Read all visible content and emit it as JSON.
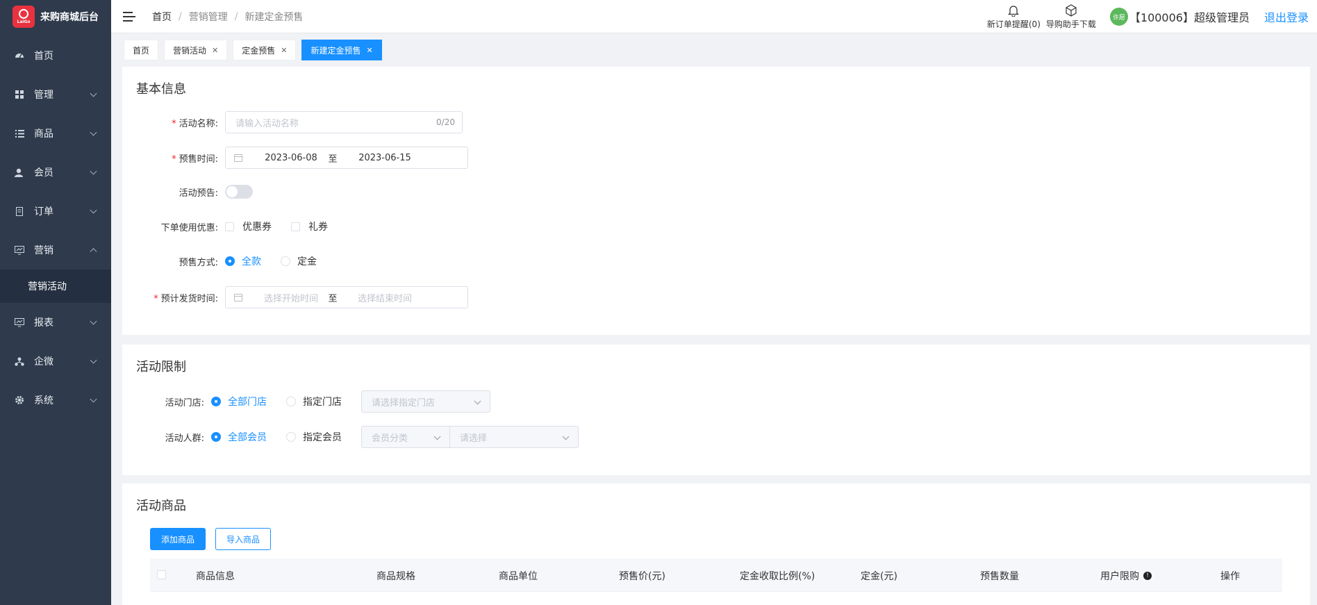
{
  "app": {
    "brand": "来购商城后台",
    "logo_text": "LaiGo"
  },
  "sidebar": {
    "items": [
      {
        "label": "首页",
        "icon": "dashboard-icon",
        "chevron": ""
      },
      {
        "label": "管理",
        "icon": "grid-icon",
        "chevron": "down"
      },
      {
        "label": "商品",
        "icon": "list-icon",
        "chevron": "down"
      },
      {
        "label": "会员",
        "icon": "user-icon",
        "chevron": "down"
      },
      {
        "label": "订单",
        "icon": "document-icon",
        "chevron": "down"
      },
      {
        "label": "营销",
        "icon": "monitor-icon",
        "chevron": "up"
      }
    ],
    "submenu": {
      "label": "营销活动"
    },
    "items_after": [
      {
        "label": "报表",
        "icon": "monitor-icon",
        "chevron": "down"
      },
      {
        "label": "企微",
        "icon": "org-icon",
        "chevron": "down"
      },
      {
        "label": "系统",
        "icon": "gear-icon",
        "chevron": "down"
      }
    ]
  },
  "header": {
    "breadcrumb": [
      "首页",
      "营销管理",
      "新建定金预售"
    ],
    "order_alert": "新订单提醒(0)",
    "download": "导购助手下载",
    "user_badge": "许愿",
    "user": "【100006】超级管理员",
    "logout": "退出登录"
  },
  "tabs": [
    {
      "label": "首页",
      "closable": false,
      "active": false
    },
    {
      "label": "营销活动",
      "closable": true,
      "active": false
    },
    {
      "label": "定金预售",
      "closable": true,
      "active": false
    },
    {
      "label": "新建定金预售",
      "closable": true,
      "active": true
    }
  ],
  "basic": {
    "title": "基本信息",
    "name_label": "活动名称:",
    "name_placeholder": "请输入活动名称",
    "name_count": "0/20",
    "presale_label": "预售时间:",
    "presale_start": "2023-06-08",
    "presale_to": "至",
    "presale_end": "2023-06-15",
    "preview_label": "活动预告:",
    "discount_label": "下单使用优惠:",
    "coupon": "优惠券",
    "gift": "礼券",
    "mode_label": "预售方式:",
    "mode_full": "全款",
    "mode_deposit": "定金",
    "ship_label": "预计发货时间:",
    "ship_start_ph": "选择开始时间",
    "ship_to": "至",
    "ship_end_ph": "选择结束时间"
  },
  "limits": {
    "title": "活动限制",
    "store_label": "活动门店:",
    "store_all": "全部门店",
    "store_specific": "指定门店",
    "store_select_ph": "请选择指定门店",
    "crowd_label": "活动人群:",
    "crowd_all": "全部会员",
    "crowd_specific": "指定会员",
    "member_cat_ph": "会员分类",
    "member_select_ph": "请选择"
  },
  "goods": {
    "title": "活动商品",
    "add_btn": "添加商品",
    "import_btn": "导入商品",
    "columns": [
      "商品信息",
      "商品规格",
      "商品单位",
      "预售价(元)",
      "定金收取比例(%)",
      "定金(元)",
      "预售数量",
      "用户限购",
      "操作"
    ]
  },
  "colors": {
    "primary": "#1890ff",
    "sidebar": "#2f3b4c",
    "required": "#f5222d"
  }
}
